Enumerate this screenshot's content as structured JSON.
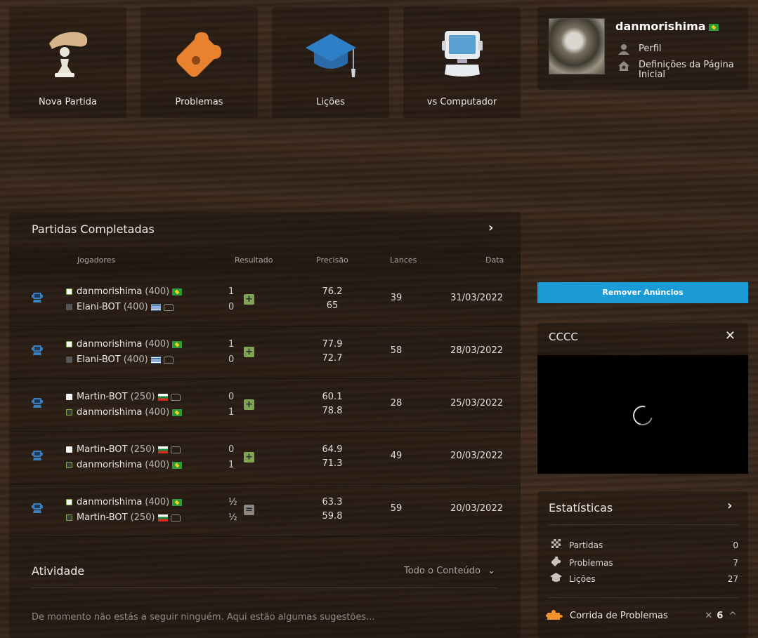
{
  "tiles": [
    {
      "label": "Nova Partida",
      "icon": "pawn-hand-icon"
    },
    {
      "label": "Problemas",
      "icon": "puzzle-icon"
    },
    {
      "label": "Lições",
      "icon": "graduation-cap-icon"
    },
    {
      "label": "vs Computador",
      "icon": "computer-icon"
    }
  ],
  "user": {
    "name": "danmorishima",
    "links": [
      {
        "label": "Perfil",
        "icon": "person-icon"
      },
      {
        "label": "Definições da Página Inicial",
        "icon": "home-settings-icon"
      }
    ]
  },
  "games": {
    "title": "Partidas Completadas",
    "headers": {
      "players": "Jogadores",
      "result": "Resultado",
      "accuracy": "Precisão",
      "moves": "Lances",
      "date": "Data"
    },
    "rows": [
      {
        "p1": {
          "name": "danmorishima",
          "rating": "(400)",
          "color": "white",
          "flag": "br",
          "bot": false
        },
        "p2": {
          "name": "Elani-BOT",
          "rating": "(400)",
          "color": "black",
          "flag": "gr",
          "bot": true
        },
        "r1": "1",
        "r2": "0",
        "result_type": "win",
        "acc1": "76.2",
        "acc2": "65",
        "moves": "39",
        "date": "31/03/2022",
        "winner": 1
      },
      {
        "p1": {
          "name": "danmorishima",
          "rating": "(400)",
          "color": "white",
          "flag": "br",
          "bot": false
        },
        "p2": {
          "name": "Elani-BOT",
          "rating": "(400)",
          "color": "black",
          "flag": "gr",
          "bot": true
        },
        "r1": "1",
        "r2": "0",
        "result_type": "win",
        "acc1": "77.9",
        "acc2": "72.7",
        "moves": "58",
        "date": "28/03/2022",
        "winner": 1
      },
      {
        "p1": {
          "name": "Martin-BOT",
          "rating": "(250)",
          "color": "white",
          "flag": "bg",
          "bot": true
        },
        "p2": {
          "name": "danmorishima",
          "rating": "(400)",
          "color": "black",
          "flag": "br",
          "bot": false
        },
        "r1": "0",
        "r2": "1",
        "result_type": "win",
        "acc1": "60.1",
        "acc2": "78.8",
        "moves": "28",
        "date": "25/03/2022",
        "winner": 2
      },
      {
        "p1": {
          "name": "Martin-BOT",
          "rating": "(250)",
          "color": "white",
          "flag": "bg",
          "bot": true
        },
        "p2": {
          "name": "danmorishima",
          "rating": "(400)",
          "color": "black",
          "flag": "br",
          "bot": false
        },
        "r1": "0",
        "r2": "1",
        "result_type": "win",
        "acc1": "64.9",
        "acc2": "71.3",
        "moves": "49",
        "date": "20/03/2022",
        "winner": 2
      },
      {
        "p1": {
          "name": "danmorishima",
          "rating": "(400)",
          "color": "white",
          "flag": "br",
          "bot": false
        },
        "p2": {
          "name": "Martin-BOT",
          "rating": "(250)",
          "color": "black",
          "flag": "bg",
          "bot": true
        },
        "r1": "½",
        "r2": "½",
        "result_type": "draw",
        "acc1": "63.3",
        "acc2": "59.8",
        "moves": "59",
        "date": "20/03/2022",
        "winner": 0
      }
    ]
  },
  "activity": {
    "title": "Atividade",
    "filter": "Todo o Conteúdo",
    "note": "De momento não estás a seguir ninguém. Aqui estão algumas sugestões..."
  },
  "ads_button": "Remover Anúncios",
  "video": {
    "title": "CCCC"
  },
  "stats": {
    "title": "Estatísticas",
    "items": [
      {
        "label": "Partidas",
        "value": "0",
        "icon": "board-icon"
      },
      {
        "label": "Problemas",
        "value": "7",
        "icon": "puzzle-icon"
      },
      {
        "label": "Lições",
        "value": "27",
        "icon": "graduation-cap-icon"
      }
    ],
    "rush": {
      "label": "Corrida de Problemas",
      "score": "6",
      "icon": "puzzle-rush-icon"
    }
  },
  "colors": {
    "accent_blue": "#1a9bd6",
    "win_green": "#7fa650",
    "puzzle_orange": "#f2922b"
  }
}
